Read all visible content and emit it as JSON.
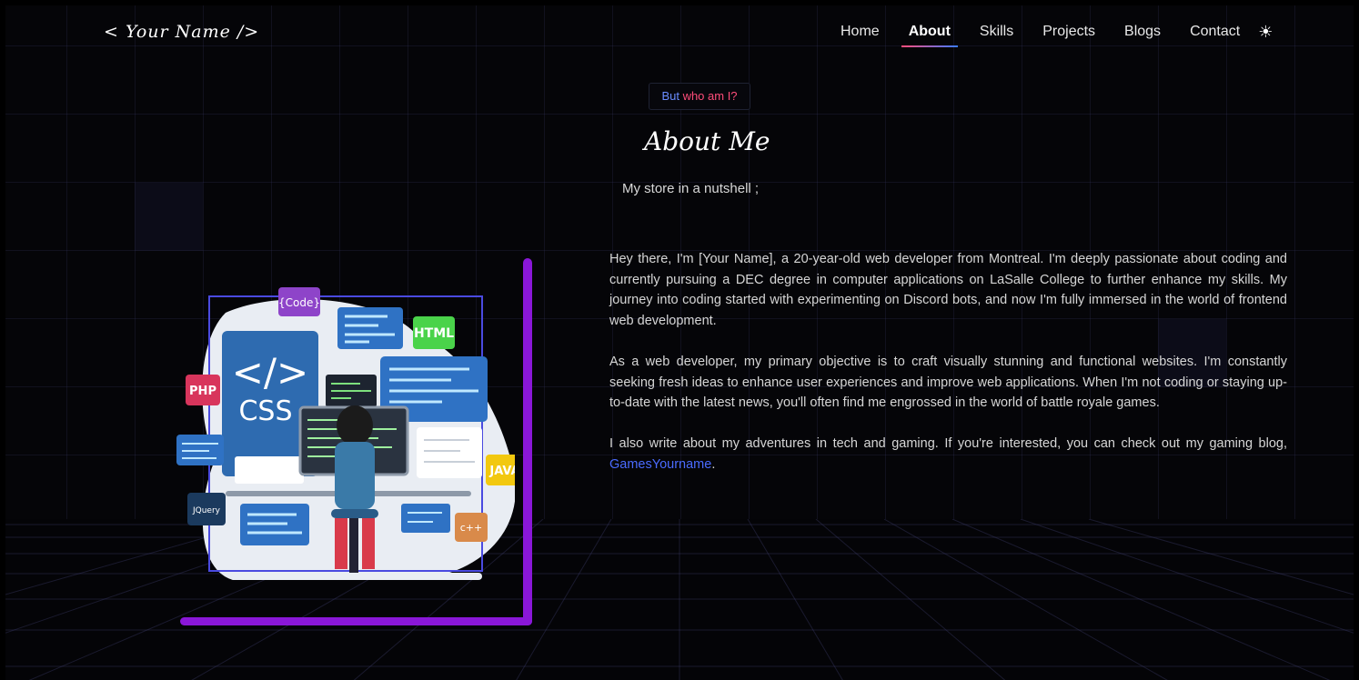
{
  "nav": {
    "logo": "< Your Name />",
    "items": [
      {
        "label": "Home",
        "active": false
      },
      {
        "label": "About",
        "active": true
      },
      {
        "label": "Skills",
        "active": false
      },
      {
        "label": "Projects",
        "active": false
      },
      {
        "label": "Blogs",
        "active": false
      },
      {
        "label": "Contact",
        "active": false
      }
    ],
    "theme_icon": "sun-icon"
  },
  "about": {
    "tag_part1": "But ",
    "tag_part2": "who am I?",
    "title": "About Me",
    "subtitle": "My store in a nutshell ;",
    "paragraph1": "Hey there, I'm [Your Name], a 20-year-old web developer from Montreal. I'm deeply passionate about coding and currently pursuing a DEC degree in computer applications on LaSalle College to further enhance my skills. My journey into coding started with experimenting on Discord bots, and now I'm fully immersed in the world of frontend web development.",
    "paragraph2": "As a web developer, my primary objective is to craft visually stunning and functional websites. I'm constantly seeking fresh ideas to enhance user experiences and improve web applications. When I'm not coding or staying up-to-date with the latest news, you'll often find me engrossed in the world of battle royale games.",
    "paragraph3_prefix": "I also write about my adventures in tech and gaming. If you're interested, you can check out my gaming blog, ",
    "blog_link": "GamesYourname",
    "paragraph3_suffix": "."
  },
  "illustration": {
    "labels": {
      "code": "{Code}",
      "html": "HTML",
      "php": "PHP",
      "css_symbol": "</>",
      "css": "CSS",
      "java": "JAVA",
      "jquery": "JQuery",
      "cpp": "c++"
    }
  },
  "colors": {
    "accent_purple": "#8a17d8",
    "link_blue": "#4a6bff",
    "tag_pink": "#ff4d7a",
    "tag_blue": "#6a8cff"
  }
}
